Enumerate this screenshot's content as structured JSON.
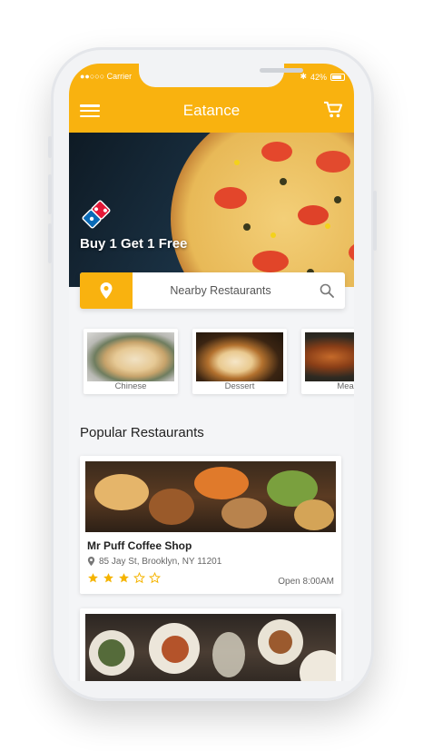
{
  "status_bar": {
    "carrier": "●●○○○ Carrier",
    "bluetooth": "✱",
    "battery": "42%"
  },
  "app_bar": {
    "title": "Eatance"
  },
  "hero": {
    "promo": "Buy 1 Get 1 Free"
  },
  "search": {
    "placeholder": "Nearby Restaurants"
  },
  "categories": [
    {
      "label": "Chinese"
    },
    {
      "label": "Dessert"
    },
    {
      "label": "Meals"
    }
  ],
  "popular": {
    "title": "Popular Restaurants"
  },
  "restaurants": [
    {
      "name": "Mr Puff Coffee Shop",
      "address": "85 Jay St, Brooklyn, NY 11201",
      "rating": 3,
      "max_rating": 5,
      "hours": "Open 8:00AM"
    }
  ],
  "colors": {
    "accent": "#f9b20f",
    "star": "#f5b400"
  }
}
